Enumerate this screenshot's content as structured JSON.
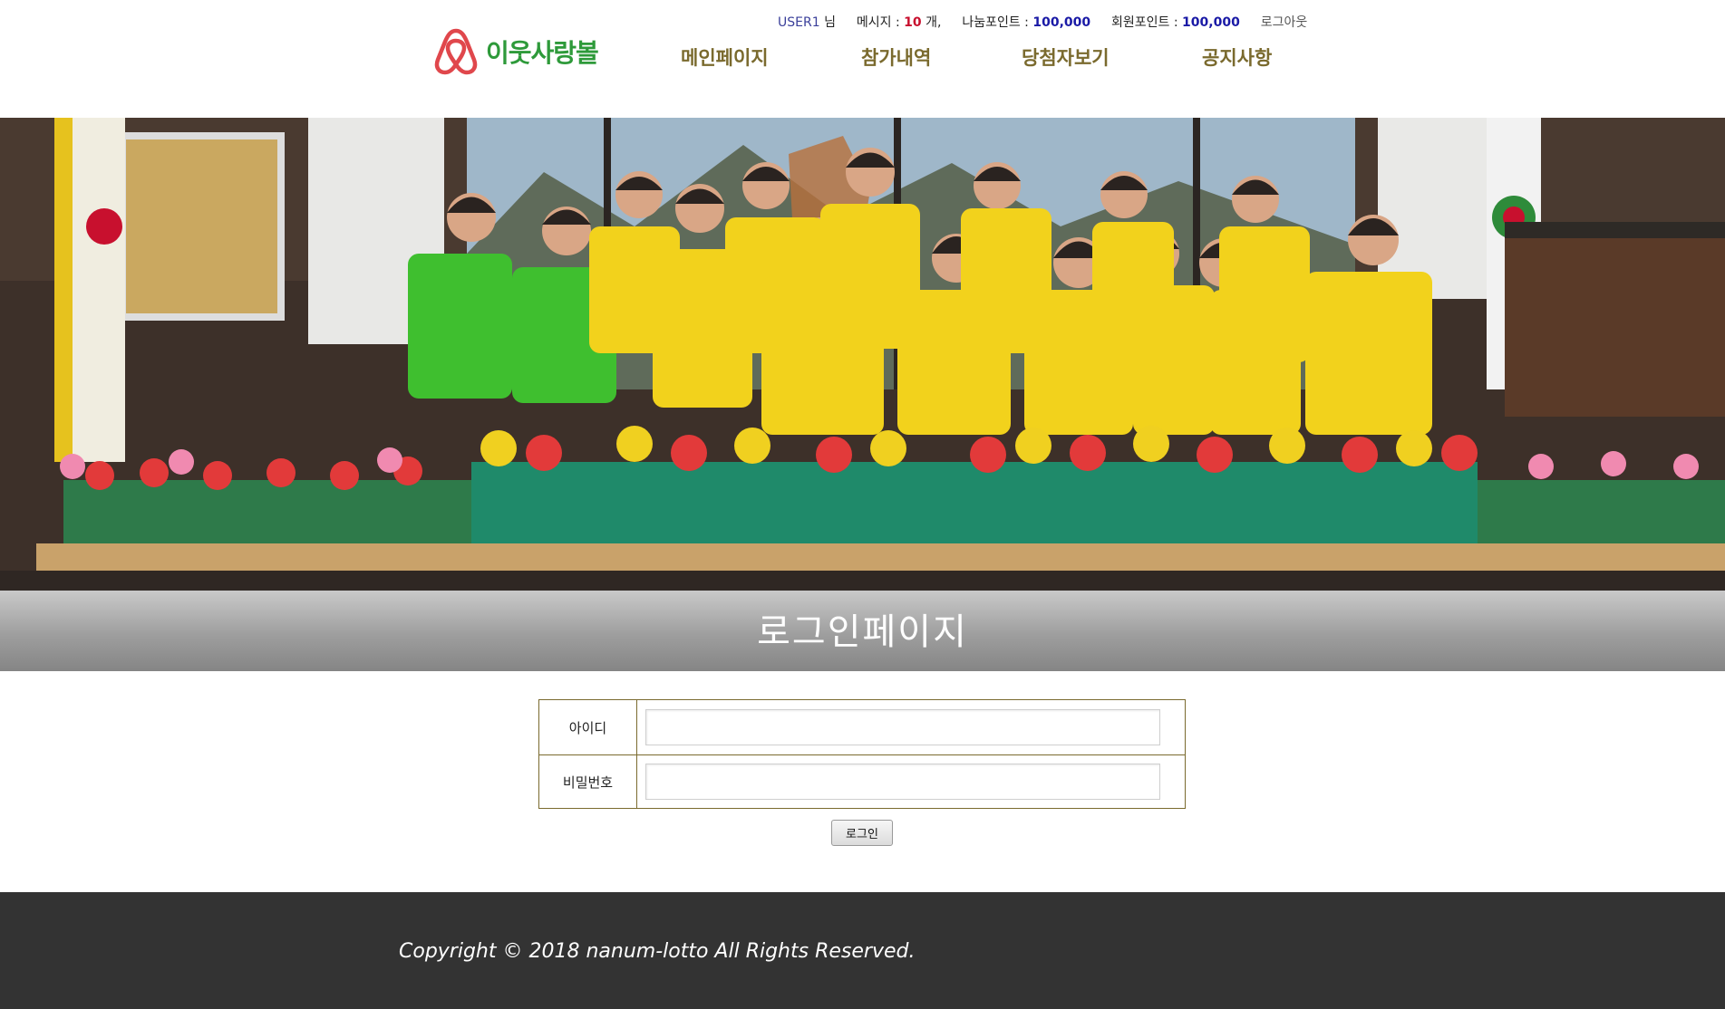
{
  "header": {
    "user_name": "USER1",
    "user_suffix": "님",
    "message_label": "메시지 : ",
    "message_count": "10",
    "message_unit": " 개,",
    "share_point_label": "나눔포인트 : ",
    "share_point_value": "100,000",
    "member_point_label": "회원포인트 : ",
    "member_point_value": "100,000",
    "logout_label": "로그아웃",
    "logo_text": "이웃사랑볼",
    "nav": [
      {
        "label": "메인페이지"
      },
      {
        "label": "참가내역"
      },
      {
        "label": "당첨자보기"
      },
      {
        "label": "공지사항"
      }
    ]
  },
  "banner": {
    "colors": {
      "vest_yellow": "#f2d21c",
      "vest_green": "#3fbf2f"
    }
  },
  "page": {
    "title": "로그인페이지"
  },
  "login": {
    "id_label": "아이디",
    "id_value": "",
    "password_label": "비밀번호",
    "password_value": "",
    "submit_label": "로그인"
  },
  "footer": {
    "copyright": "Copyright © 2018 nanum-lotto All Rights Reserved."
  },
  "colors": {
    "nav_text": "#7a6a2e",
    "logo_green": "#2e9a3a",
    "logo_icon": "#e0474c",
    "footer_bg": "#333333"
  }
}
